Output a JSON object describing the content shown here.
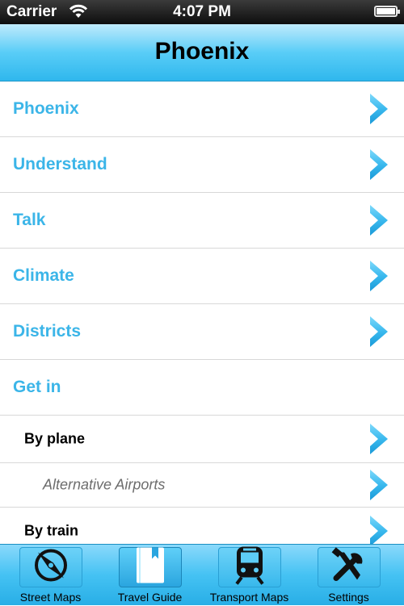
{
  "status_bar": {
    "carrier": "Carrier",
    "time": "4:07 PM"
  },
  "nav": {
    "title": "Phoenix"
  },
  "rows": [
    {
      "label": "Phoenix",
      "level": 1,
      "chevron": true
    },
    {
      "label": "Understand",
      "level": 1,
      "chevron": true
    },
    {
      "label": "Talk",
      "level": 1,
      "chevron": true
    },
    {
      "label": "Climate",
      "level": 1,
      "chevron": true
    },
    {
      "label": "Districts",
      "level": 1,
      "chevron": true
    },
    {
      "label": "Get in",
      "level": 1,
      "chevron": false
    },
    {
      "label": "By plane",
      "level": 2,
      "chevron": true
    },
    {
      "label": "Alternative Airports",
      "level": 3,
      "chevron": true
    },
    {
      "label": "By train",
      "level": 2,
      "chevron": true
    }
  ],
  "tabs": [
    {
      "label": "Street Maps",
      "icon": "compass-icon",
      "active": false
    },
    {
      "label": "Travel Guide",
      "icon": "book-icon",
      "active": true
    },
    {
      "label": "Transport Maps",
      "icon": "train-icon",
      "active": false
    },
    {
      "label": "Settings",
      "icon": "tools-icon",
      "active": false
    }
  ],
  "colors": {
    "accent": "#3bb5e8",
    "nav_gradient_mid": "#59cdf7",
    "tabbar": "#45c2f3"
  }
}
